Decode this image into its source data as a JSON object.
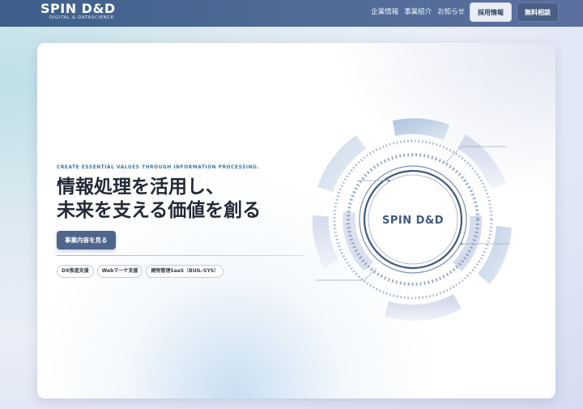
{
  "header": {
    "logo": {
      "main": "SPIN D&D",
      "sub": "DIGITAL & DATASCIENCE"
    },
    "nav": [
      {
        "label": "企業情報"
      },
      {
        "label": "事業紹介"
      },
      {
        "label": "お知らせ"
      }
    ],
    "buttons": {
      "recruit": "採用情報",
      "consult": "無料相談"
    }
  },
  "hero": {
    "eyebrow": "CREATE ESSENTIAL VALUES THROUGH INFORMATION PROCESSING.",
    "headline_line1": "情報処理を活用し、",
    "headline_line2": "未来を支える価値を創る",
    "cta": "事業内容を見る",
    "tags": [
      {
        "label": "DX推進支援"
      },
      {
        "label": "Webマーケ支援"
      },
      {
        "label": "建物管理SaaS（BUIL-SYS）"
      }
    ],
    "emblem_text": "SPIN D&D"
  },
  "colors": {
    "header_bg": "#4a6590",
    "accent": "#3a78a8",
    "cta_bg": "#4e658c",
    "headline": "#222a36"
  }
}
